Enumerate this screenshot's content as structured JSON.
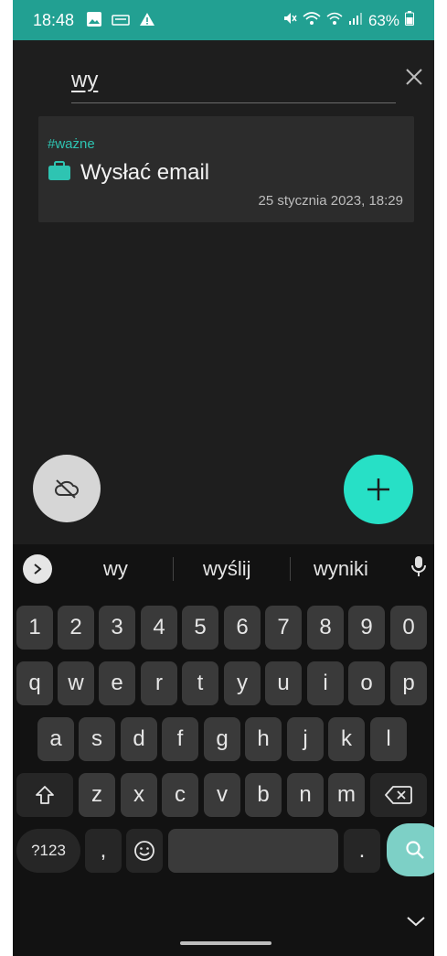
{
  "status_bar": {
    "time": "18:48",
    "battery": "63%",
    "icons": [
      "image-notification-icon",
      "tv-notification-icon",
      "warning-icon",
      "mute-icon",
      "wifi-icon",
      "signal-icon",
      "battery-icon"
    ]
  },
  "search": {
    "query": "wy"
  },
  "notes": [
    {
      "tag": "#ważne",
      "title": "Wysłać email",
      "date": "25 stycznia 2023, 18:29",
      "icon": "briefcase-icon"
    }
  ],
  "suggestions": [
    "wy",
    "wyślij",
    "wyniki"
  ],
  "keyboard": {
    "row_numbers": [
      "1",
      "2",
      "3",
      "4",
      "5",
      "6",
      "7",
      "8",
      "9",
      "0"
    ],
    "row_1": [
      "q",
      "w",
      "e",
      "r",
      "t",
      "y",
      "u",
      "i",
      "o",
      "p"
    ],
    "row_2": [
      "a",
      "s",
      "d",
      "f",
      "g",
      "h",
      "j",
      "k",
      "l"
    ],
    "row_3": [
      "z",
      "x",
      "c",
      "v",
      "b",
      "n",
      "m"
    ],
    "symbols_label": "?123",
    "comma_label": ",",
    "period_label": "."
  },
  "colors": {
    "accent": "#27e0c6",
    "status_bar": "#22a092",
    "tag_text": "#2ec4b2",
    "card_bg": "#2c2c2c",
    "background": "#1e1e1e"
  }
}
